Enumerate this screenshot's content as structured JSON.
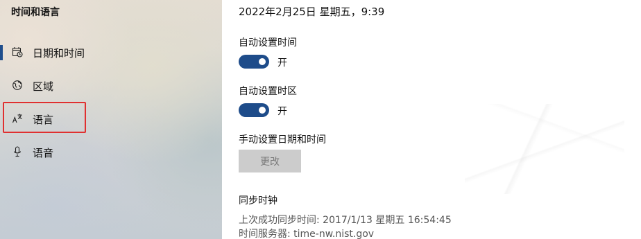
{
  "sidebar": {
    "title": "时间和语言",
    "items": [
      {
        "label": "日期和时间",
        "icon": "calendar-clock-icon",
        "active": true
      },
      {
        "label": "区域",
        "icon": "globe-icon",
        "active": false
      },
      {
        "label": "语言",
        "icon": "language-icon",
        "active": false,
        "highlighted": true
      },
      {
        "label": "语音",
        "icon": "microphone-icon",
        "active": false
      }
    ]
  },
  "main": {
    "current_time": "2022年2月25日 星期五，9:39",
    "auto_time": {
      "label": "自动设置时间",
      "state": "开",
      "on": true
    },
    "auto_timezone": {
      "label": "自动设置时区",
      "state": "开",
      "on": true
    },
    "manual": {
      "label": "手动设置日期和时间",
      "button": "更改",
      "button_enabled": false
    },
    "sync": {
      "heading": "同步时钟",
      "last_sync": "上次成功同步时间: 2017/1/13 星期五 16:54:45",
      "server": "时间服务器: time-nw.nist.gov"
    }
  },
  "colors": {
    "accent": "#1e4c8a",
    "highlight_box": "#e03030",
    "disabled_button": "#cccccc"
  }
}
